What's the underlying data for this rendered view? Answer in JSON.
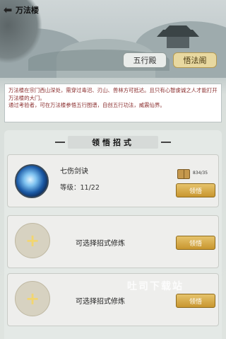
{
  "header": {
    "title": "万法楼"
  },
  "tabs": [
    {
      "label": "五行殿",
      "active": false
    },
    {
      "label": "悟法阁",
      "active": true
    }
  ],
  "description": {
    "line1": "万法楼在宗门西山深处，需穿过毒沼、刃山、兽林方可抵达。且只有心智虔诚之人才能打开万法楼的大门。",
    "line2": "通过考验者，可在万法楼参悟五行图谱，自创五行功法，威震仙界。"
  },
  "section": {
    "title": "领悟招式"
  },
  "skills": [
    {
      "name": "七伤剑诀",
      "level_text": "等级：11/22",
      "book_count": "834/35",
      "button": "领悟"
    }
  ],
  "empty_slots": [
    {
      "label": "可选择招式修炼",
      "button": "领悟"
    },
    {
      "label": "可选择招式修炼",
      "button": "领悟"
    }
  ],
  "watermark": "吐司下载站",
  "colors": {
    "gold_button": "#d4a544",
    "desc_text": "#8a2d2d",
    "tab_active": "#e8d8a0"
  }
}
